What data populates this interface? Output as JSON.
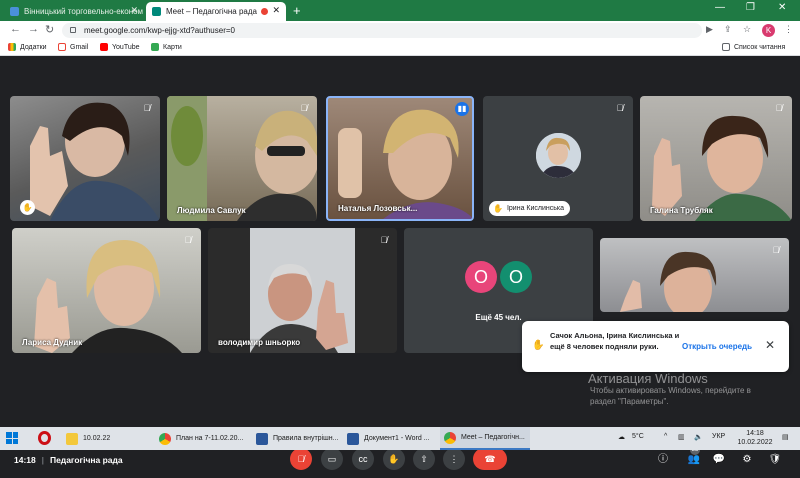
{
  "browser": {
    "tabs": [
      {
        "title": "Вінницький торговельно-економ",
        "active": false
      },
      {
        "title": "Meet – Педагогічна рада",
        "active": true
      }
    ],
    "url": "meet.google.com/kwp-ejjg-xtd?authuser=0",
    "profile_initial": "K",
    "bookmarks": [
      "Додатки",
      "Gmail",
      "YouTube",
      "Карти"
    ],
    "reading_list": "Список читання"
  },
  "meeting": {
    "participants": [
      {
        "name": ""
      },
      {
        "name": "Людмила Савлук"
      },
      {
        "name": "Наталья Лозовськ..."
      },
      {
        "name": "Ірина Кислинська"
      },
      {
        "name": "Галина Трубляк"
      },
      {
        "name": "Лариса Дудник"
      },
      {
        "name": "володимир шньорко"
      },
      {
        "name": ""
      }
    ],
    "more_tile": {
      "initials": [
        "О",
        "О"
      ],
      "label": "Ещё 45 чел."
    },
    "notification": {
      "text": "Сачок Альона, Ірина Кислинська и ещё 8 человек подняли руки.",
      "action": "Открыть очередь"
    },
    "time": "14:18",
    "title": "Педагогічна рада",
    "participant_count": "53"
  },
  "watermark": {
    "title": "Активация Windows",
    "text": "Чтобы активировать Windows, перейдите в раздел \"Параметры\"."
  },
  "taskbar": {
    "items": [
      "10.02.22",
      "План на 7-11.02.20...",
      "Правила внутрішн...",
      "Документ1 - Word ...",
      "Meet – Педагогічн..."
    ],
    "temperature": "5°C",
    "language": "УКР",
    "time": "14:18",
    "date": "10.02.2022"
  }
}
